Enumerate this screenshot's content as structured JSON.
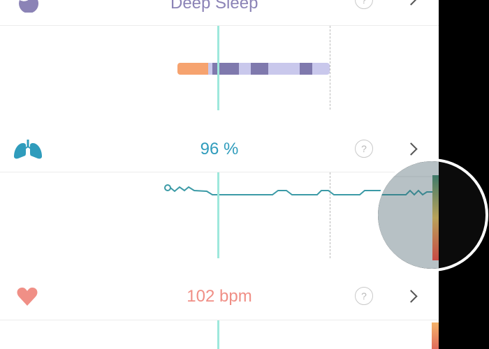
{
  "deep_sleep": {
    "label": "Deep Sleep",
    "color": "#8b83b6"
  },
  "spo2": {
    "value": "96 %",
    "color": "#2f9cbc",
    "icon": "lungs-icon"
  },
  "heart_rate": {
    "value": "102 bpm",
    "color": "#f08f86",
    "icon": "heart-icon"
  },
  "help_symbol": "?",
  "sleep_stage_colors": {
    "awake": "#f6a36f",
    "deep": "#7f79ad",
    "light": "#c9c8ec"
  },
  "spo2_line_color": "#3b9aa6"
}
